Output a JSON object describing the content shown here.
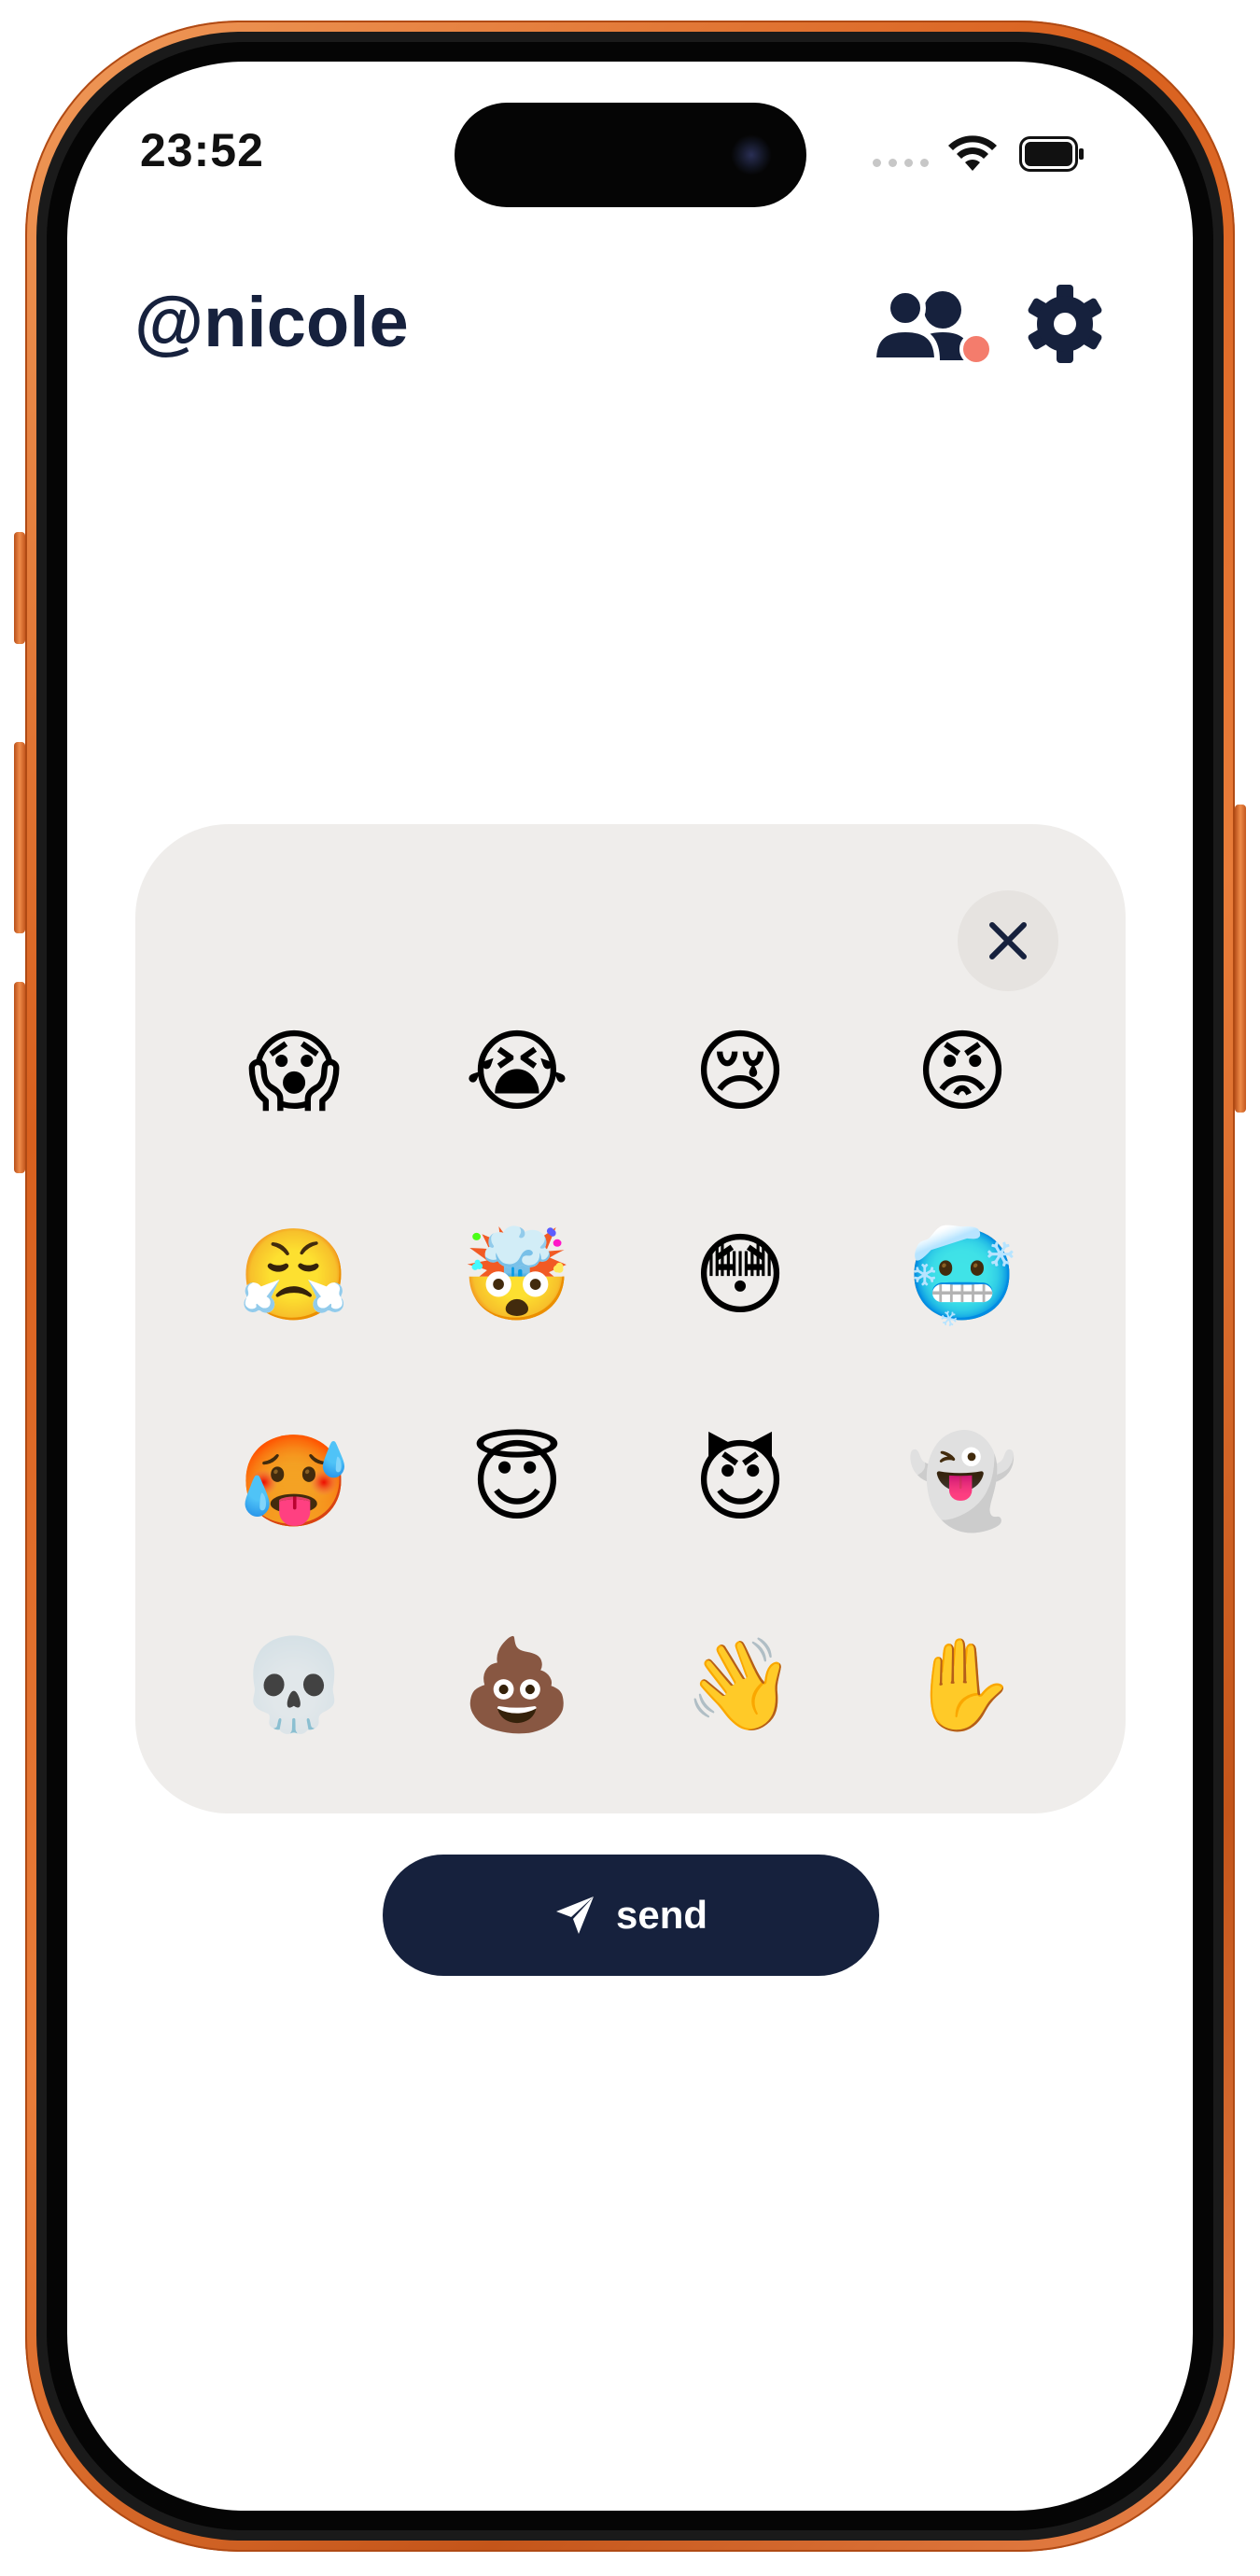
{
  "status_bar": {
    "time": "23:52",
    "icons": [
      "signal-dots-icon",
      "wifi-icon",
      "battery-icon"
    ]
  },
  "header": {
    "username": "@nicole",
    "friends_icon": "people-icon",
    "friends_badge_color": "#f47c6c",
    "settings_icon": "gear-icon"
  },
  "emoji_panel": {
    "close_icon": "close-icon",
    "emojis": [
      "😱",
      "😭",
      "😢",
      "😡",
      "😤",
      "🤯",
      "😳",
      "🥶",
      "🥵",
      "😇",
      "😈",
      "👻",
      "💀",
      "💩",
      "👋",
      "✋"
    ]
  },
  "send_button": {
    "label": "send",
    "icon": "paper-plane-icon"
  },
  "colors": {
    "accent": "#16213d",
    "panel_bg": "#efedeb",
    "frame": "#e0702e"
  }
}
